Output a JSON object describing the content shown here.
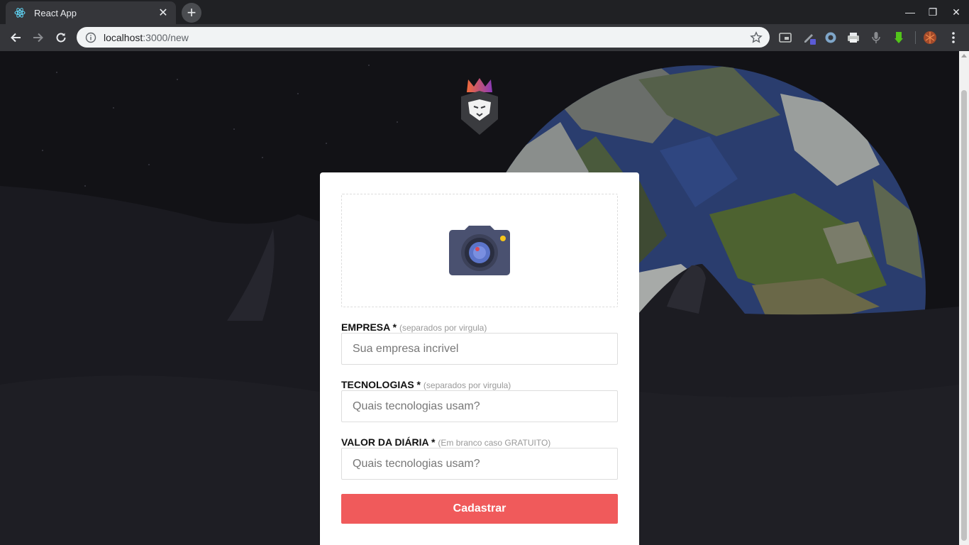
{
  "browser": {
    "tab_title": "React App",
    "tab_close": "✕",
    "new_tab": "+",
    "url_host": "localhost",
    "url_path": ":3000/new",
    "window_controls": {
      "minimize": "—",
      "maximize": "❐",
      "close": "✕"
    }
  },
  "icons": {
    "favicon": "react-icon",
    "back": "back-arrow-icon",
    "forward": "forward-arrow-icon",
    "reload": "reload-icon",
    "info": "info-icon",
    "bookmark": "star-icon",
    "menu": "kebab-menu-icon",
    "logo": "lion-logo-icon",
    "camera": "camera-icon"
  },
  "form": {
    "company": {
      "label": "EMPRESA *",
      "hint": "(separados por virgula)",
      "placeholder": "Sua empresa incrivel"
    },
    "techs": {
      "label": "TECNOLOGIAS *",
      "hint": "(separados por virgula)",
      "placeholder": "Quais tecnologias usam?"
    },
    "price": {
      "label": "VALOR DA DIÁRIA *",
      "hint": "(Em branco caso GRATUITO)",
      "placeholder": "Quais tecnologias usam?"
    },
    "submit_label": "Cadastrar"
  },
  "colors": {
    "accent": "#f05a5b",
    "card": "#ffffff",
    "page_bg": "#121216",
    "chrome_dark": "#202124",
    "chrome_toolbar": "#35363a"
  }
}
